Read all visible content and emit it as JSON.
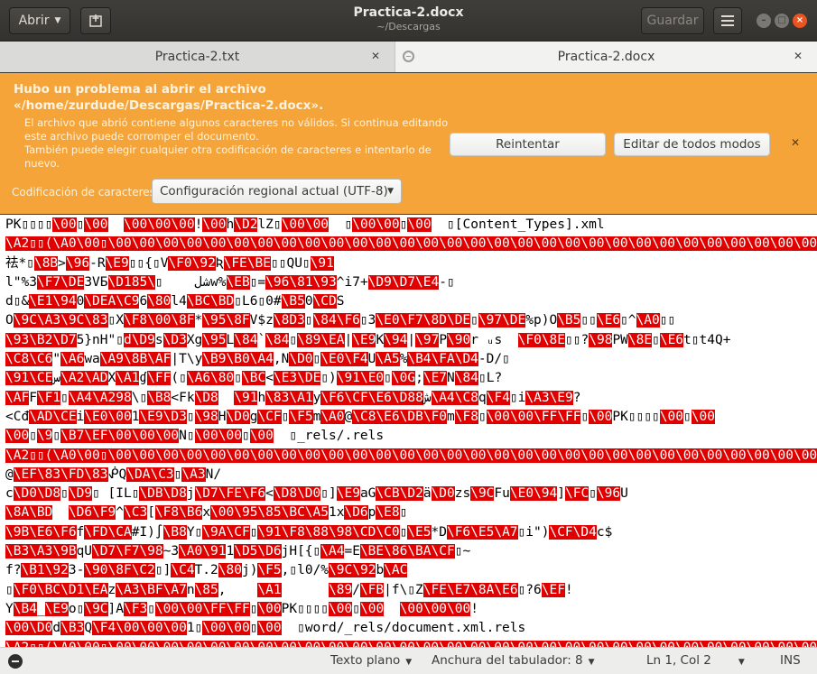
{
  "header": {
    "open_label": "Abrir",
    "title": "Practica-2.docx",
    "subtitle": "~/Descargas",
    "save_label": "Guardar"
  },
  "tabs": [
    {
      "label": "Practica-2.txt"
    },
    {
      "label": "Practica-2.docx"
    }
  ],
  "infobar": {
    "title": "Hubo un problema al abrir el archivo «/home/zurdude/Descargas/Practica-2.docx».",
    "desc": "El archivo que abrió contiene algunos caracteres no válidos. Si continua editando este archivo puede corromper el documento.\nTambién puede elegir cualquier otra codificación de caracteres e intentarlo de nuevo.",
    "retry_label": "Reintentar",
    "edit_anyway_label": "Editar de todos modos",
    "encoding_label": "Codificación de caracteres:",
    "encoding_value": "Configuración regional actual (UTF-8)"
  },
  "editor": {
    "lines": [
      [
        [
          "PK▯▯▯▯",
          0
        ],
        [
          "\\00",
          1
        ],
        [
          "▯",
          0
        ],
        [
          "\\00",
          1
        ],
        [
          "  ",
          0
        ],
        [
          "\\00\\00\\00",
          1
        ],
        [
          "!",
          0
        ],
        [
          "\\00",
          1
        ],
        [
          "h",
          0
        ],
        [
          "\\D2",
          1
        ],
        [
          "lZ▯",
          0
        ],
        [
          "\\00\\00",
          1
        ],
        [
          "  ▯",
          0
        ],
        [
          "\\00\\00",
          1
        ],
        [
          "▯",
          0
        ],
        [
          "\\00",
          1
        ],
        [
          "  ▯[Content_Types].xml",
          0
        ]
      ],
      [
        [
          "\\A2▯▯(\\A0\\00▯\\00\\00\\00\\00\\00\\00\\00\\00\\00\\00\\00\\00\\00\\00\\00\\00\\00\\00\\00\\00\\00\\00\\00\\00\\00\\00\\00\\00\\00\\00\\00\\00",
          1
        ]
      ],
      [
        [
          "祛*▯",
          0
        ],
        [
          "\\8B",
          1
        ],
        [
          ">",
          0
        ],
        [
          "\\96",
          1
        ],
        [
          "-R",
          0
        ],
        [
          "\\E9",
          1
        ],
        [
          "▯▯",
          0
        ],
        [
          "{▯V",
          0
        ],
        [
          "\\F0",
          1
        ],
        [
          "\\92",
          1
        ],
        [
          "Ʀ",
          0
        ],
        [
          "\\FE",
          1
        ],
        [
          "\\BE",
          1
        ],
        [
          "▯▯QU▯",
          0
        ],
        [
          "\\91",
          1
        ]
      ],
      [
        [
          "l\"%3",
          0
        ],
        [
          "\\F7\\DE",
          1
        ],
        [
          "3VБ",
          0
        ],
        [
          "\\D1",
          1
        ],
        [
          "شل    ▯",
          0
        ],
        [
          "\\85",
          1
        ],
        [
          "w%",
          0
        ],
        [
          "\\EB",
          1
        ],
        [
          "▯=",
          0
        ],
        [
          "\\96\\81\\93",
          1
        ],
        [
          "^i7+",
          0
        ],
        [
          "\\D9\\D7\\E4",
          1
        ],
        [
          "-▯",
          0
        ]
      ],
      [
        [
          "d▯&",
          0
        ],
        [
          "\\E1\\94",
          1
        ],
        [
          "0",
          0
        ],
        [
          "\\DEA",
          1
        ],
        [
          "\\C9",
          1
        ],
        [
          "6",
          0
        ],
        [
          "\\80",
          1
        ],
        [
          "l4",
          0
        ],
        [
          "\\BC\\BD",
          1
        ],
        [
          "▯L6▯0#",
          0
        ],
        [
          "\\B5",
          1
        ],
        [
          "0",
          0
        ],
        [
          "\\CD",
          1
        ],
        [
          "S",
          0
        ]
      ],
      [
        [
          "O",
          0
        ],
        [
          "\\9C\\A3\\9C\\83",
          1
        ],
        [
          "▯X",
          0
        ],
        [
          "\\F8\\00\\8F",
          1
        ],
        [
          "*",
          0
        ],
        [
          "\\95\\8F",
          1
        ],
        [
          "V$z",
          0
        ],
        [
          "\\8D3",
          1
        ],
        [
          "▯",
          0
        ],
        [
          "\\84\\F6",
          1
        ],
        [
          "▯3",
          0
        ],
        [
          "\\E0\\F7\\8D\\DE",
          1
        ],
        [
          "▯",
          0
        ],
        [
          "\\97\\DE",
          1
        ],
        [
          "%p)O",
          0
        ],
        [
          "\\B5",
          1
        ],
        [
          "▯▯",
          0
        ],
        [
          "\\E6",
          1
        ],
        [
          "▯^",
          0
        ],
        [
          "\\A0",
          1
        ],
        [
          "▯▯",
          0
        ]
      ],
      [
        [
          "\\93\\B2\\D7",
          1
        ],
        [
          "5}nH\"",
          0
        ],
        [
          "▯",
          0
        ],
        [
          "d\\D9",
          1
        ],
        [
          "s",
          0
        ],
        [
          "\\D3",
          1
        ],
        [
          "Xg",
          0
        ],
        [
          "\\95",
          1
        ],
        [
          "L",
          0
        ],
        [
          "\\84",
          1
        ],
        [
          "`",
          0
        ],
        [
          "\\84",
          1
        ],
        [
          "▯",
          0
        ],
        [
          "\\89\\EA",
          1
        ],
        [
          "|",
          0
        ],
        [
          "\\E9",
          1
        ],
        [
          "K",
          0
        ],
        [
          "\\94",
          1
        ],
        [
          "|",
          0
        ],
        [
          "\\97",
          1
        ],
        [
          "P",
          0
        ],
        [
          "\\90",
          1
        ],
        [
          "r ᵤs  ",
          0
        ],
        [
          "\\F0\\8E",
          1
        ],
        [
          "▯▯?",
          0
        ],
        [
          "\\98",
          1
        ],
        [
          "PW",
          0
        ],
        [
          "\\8E",
          1
        ],
        [
          "▯",
          0
        ],
        [
          "\\E6",
          1
        ],
        [
          "t▯t4Q+",
          0
        ]
      ],
      [
        [
          "\\C8\\C6",
          1
        ],
        [
          "\"",
          0
        ],
        [
          "\\A6",
          1
        ],
        [
          "wa",
          0
        ],
        [
          "\\A9\\8B\\AF",
          1
        ],
        [
          "|T\\y",
          0
        ],
        [
          "\\B9\\B0\\A4",
          1
        ],
        [
          ",N",
          0
        ],
        [
          "\\D0",
          1
        ],
        [
          "▯",
          0
        ],
        [
          "\\E0\\F4",
          1
        ],
        [
          "U",
          0
        ],
        [
          "\\A5",
          1
        ],
        [
          "%",
          0
        ],
        [
          "\\B4\\FA\\D4",
          1
        ],
        [
          "-D/▯",
          0
        ]
      ],
      [
        [
          "\\91\\CE",
          1
        ],
        [
          "س",
          0
        ],
        [
          "\\A2\\AD",
          1
        ],
        [
          "X",
          0
        ],
        [
          "\\A1",
          1
        ],
        [
          "ɠ",
          0
        ],
        [
          "\\FF",
          1
        ],
        [
          "(▯",
          0
        ],
        [
          "\\A6\\80",
          1
        ],
        [
          "▯",
          0
        ],
        [
          "\\BC",
          1
        ],
        [
          "<",
          0
        ],
        [
          "\\E3\\DE",
          1
        ],
        [
          "▯)",
          0
        ],
        [
          "\\91\\E0",
          1
        ],
        [
          "▯",
          0
        ],
        [
          "\\0G",
          1
        ],
        [
          ";",
          0
        ],
        [
          "\\E7",
          1
        ],
        [
          "N",
          0
        ],
        [
          "\\84",
          1
        ],
        [
          "▯L?",
          0
        ]
      ],
      [
        [
          "\\AF",
          1
        ],
        [
          "F",
          0
        ],
        [
          "\\F1",
          1
        ],
        [
          "▯",
          0
        ],
        [
          "\\A4\\A298",
          1
        ],
        [
          "\\",
          0
        ],
        [
          "▯",
          0
        ],
        [
          "\\B8",
          1
        ],
        [
          "<Fk",
          0
        ],
        [
          "\\D8",
          1
        ],
        [
          "  ",
          0
        ],
        [
          "\\91",
          1
        ],
        [
          "h",
          0
        ],
        [
          "\\83",
          1
        ],
        [
          "\\A1",
          1
        ],
        [
          "y",
          0
        ],
        [
          "\\F6\\CF\\E6\\D88",
          1
        ],
        [
          "ش",
          0
        ],
        [
          "\\A4\\C8",
          1
        ],
        [
          "q",
          0
        ],
        [
          "\\F4",
          1
        ],
        [
          "▯i",
          0
        ],
        [
          "\\A3\\E9",
          1
        ],
        [
          "?",
          0
        ]
      ],
      [
        [
          "<Cđ",
          0
        ],
        [
          "\\AD\\CE",
          1
        ],
        [
          "i",
          0
        ],
        [
          "\\E0\\00",
          1
        ],
        [
          "1",
          0
        ],
        [
          "\\E9\\D3",
          1
        ],
        [
          "▯",
          0
        ],
        [
          "\\98",
          1
        ],
        [
          "H",
          0
        ],
        [
          "\\D0",
          1
        ],
        [
          "g",
          0
        ],
        [
          "\\CF",
          1
        ],
        [
          "▯",
          0
        ],
        [
          "\\F5",
          1
        ],
        [
          "m",
          0
        ],
        [
          "\\A0",
          1
        ],
        [
          "@",
          0
        ],
        [
          "\\C8\\E6\\DB\\F0",
          1
        ],
        [
          "m",
          0
        ],
        [
          "\\F8",
          1
        ],
        [
          "▯",
          0
        ],
        [
          "\\00\\00\\FF\\FF",
          1
        ],
        [
          "▯",
          0
        ],
        [
          "\\00",
          1
        ],
        [
          "PK▯▯▯▯",
          0
        ],
        [
          "\\00",
          1
        ],
        [
          "▯",
          0
        ],
        [
          "\\00",
          1
        ]
      ],
      [
        [
          "\\00",
          1
        ],
        [
          "▯",
          0
        ],
        [
          "\\9",
          1
        ],
        [
          "▯",
          0
        ],
        [
          "\\B7\\EF\\00\\00\\00",
          1
        ],
        [
          "N▯",
          0
        ],
        [
          "\\00\\00",
          1
        ],
        [
          "▯",
          0
        ],
        [
          "\\00",
          1
        ],
        [
          "  ▯_rels/.rels",
          0
        ]
      ],
      [
        [
          "\\A2▯▯(\\A0\\00▯\\00\\00\\00\\00\\00\\00\\00\\00\\00\\00\\00\\00\\00\\00\\00\\00\\00\\00\\00\\00\\00\\00\\00\\00\\00\\00\\00\\00\\00\\00\\00",
          1
        ]
      ],
      [
        [
          "@",
          0
        ],
        [
          "\\EF\\83\\FD\\83",
          1
        ],
        [
          "ᕶQ",
          0
        ],
        [
          "\\DA\\C3",
          1
        ],
        [
          "▯",
          0
        ],
        [
          "\\A3",
          1
        ],
        [
          "N/",
          0
        ]
      ],
      [
        [
          "c",
          0
        ],
        [
          "\\D0\\D8",
          1
        ],
        [
          "▯",
          0
        ],
        [
          "\\D9",
          1
        ],
        [
          "▯ [IL▯",
          0
        ],
        [
          "\\DB\\D8",
          1
        ],
        [
          "j",
          0
        ],
        [
          "\\D7\\FE\\F6",
          1
        ],
        [
          "<",
          0
        ],
        [
          "\\D8\\D0",
          1
        ],
        [
          "▯]",
          0
        ],
        [
          "\\E9",
          1
        ],
        [
          "aG",
          0
        ],
        [
          "\\CB\\D2",
          1
        ],
        [
          "ä",
          0
        ],
        [
          "\\D0",
          1
        ],
        [
          "zs",
          0
        ],
        [
          "\\9C",
          1
        ],
        [
          "Fu",
          0
        ],
        [
          "\\E0\\94",
          1
        ],
        [
          "]",
          0
        ],
        [
          "\\FC",
          1
        ],
        [
          "▯",
          0
        ],
        [
          "\\96",
          1
        ],
        [
          "U",
          0
        ]
      ],
      [
        [
          "\\8A\\BD",
          1
        ],
        [
          "  ",
          0
        ],
        [
          "\\D6\\F9",
          1
        ],
        [
          "^",
          0
        ],
        [
          "\\C3",
          1
        ],
        [
          "[",
          0
        ],
        [
          "\\F8\\B6",
          1
        ],
        [
          "x",
          0
        ],
        [
          "\\00\\95\\85\\BC\\A5",
          1
        ],
        [
          "1x",
          0
        ],
        [
          "\\D6",
          1
        ],
        [
          "p",
          0
        ],
        [
          "\\E8",
          1
        ],
        [
          "▯",
          0
        ]
      ],
      [
        [
          "\\9B\\E6\\F6",
          1
        ],
        [
          "f",
          0
        ],
        [
          "\\FD\\CA",
          1
        ],
        [
          "#I)∫",
          0
        ],
        [
          "\\B8",
          1
        ],
        [
          "Y▯",
          0
        ],
        [
          "\\9A\\CF",
          1
        ],
        [
          "▯",
          0
        ],
        [
          "\\91\\F8\\88\\98\\CD\\C0",
          1
        ],
        [
          "▯",
          0
        ],
        [
          "\\E5",
          1
        ],
        [
          "*D",
          0
        ],
        [
          "\\F6\\E5\\A7",
          1
        ],
        [
          "▯i\")",
          0
        ],
        [
          "\\CF\\D4",
          1
        ],
        [
          "c$",
          0
        ]
      ],
      [
        [
          "\\B3\\A3\\9B",
          1
        ],
        [
          "qU",
          0
        ],
        [
          "\\D7\\F7\\98",
          1
        ],
        [
          "~3",
          0
        ],
        [
          "\\A0\\91",
          1
        ],
        [
          "1",
          0
        ],
        [
          "\\D5\\D6",
          1
        ],
        [
          "jH[{▯",
          0
        ],
        [
          "\\A4",
          1
        ],
        [
          "=E",
          0
        ],
        [
          "\\BE\\86",
          1
        ],
        [
          "\\BA\\CF",
          1
        ],
        [
          "▯~",
          0
        ]
      ],
      [
        [
          "f?",
          0
        ],
        [
          "\\B1\\92",
          1
        ],
        [
          "3-",
          0
        ],
        [
          "\\90\\8F\\C2",
          1
        ],
        [
          "▯]",
          0
        ],
        [
          "\\C4",
          1
        ],
        [
          "T.2",
          0
        ],
        [
          "\\80",
          1
        ],
        [
          "j)",
          0
        ],
        [
          "\\F5",
          1
        ],
        [
          ",▯l0/%",
          0
        ],
        [
          "\\9C\\92",
          1
        ],
        [
          "b",
          0
        ],
        [
          "\\AC",
          1
        ]
      ],
      [
        [
          "▯",
          0
        ],
        [
          "\\F0\\BC\\D1\\EA",
          1
        ],
        [
          "z",
          0
        ],
        [
          "\\A3\\BF\\A7",
          1
        ],
        [
          "n",
          0
        ],
        [
          "\\85",
          1
        ],
        [
          ",    ",
          0
        ],
        [
          "\\A1",
          1
        ],
        [
          "      ",
          0
        ],
        [
          "\\89",
          1
        ],
        [
          "/",
          0
        ],
        [
          "\\FB",
          1
        ],
        [
          "|f\\▯Z",
          0
        ],
        [
          "\\FE\\E7\\8A\\E6",
          1
        ],
        [
          "▯?6",
          0
        ],
        [
          "\\EF",
          1
        ],
        [
          "!",
          0
        ]
      ],
      [
        [
          "Y",
          0
        ],
        [
          "\\B4",
          1
        ],
        [
          "_",
          0
        ],
        [
          "\\E9",
          1
        ],
        [
          "o▯",
          0
        ],
        [
          "\\9C",
          1
        ],
        [
          "]A",
          0
        ],
        [
          "\\F3",
          1
        ],
        [
          "▯",
          0
        ],
        [
          "\\00\\00\\FF\\FF",
          1
        ],
        [
          "▯",
          0
        ],
        [
          "\\00",
          1
        ],
        [
          "PK▯▯▯▯",
          0
        ],
        [
          "\\00",
          1
        ],
        [
          "▯",
          0
        ],
        [
          "\\00",
          1
        ],
        [
          "  ",
          0
        ],
        [
          "\\00\\00\\00",
          1
        ],
        [
          "!",
          0
        ]
      ],
      [
        [
          "\\00\\D0",
          1
        ],
        [
          "d",
          0
        ],
        [
          "\\B3",
          1
        ],
        [
          "Q",
          0
        ],
        [
          "\\F4\\00\\00\\00",
          1
        ],
        [
          "1▯",
          0
        ],
        [
          "\\00\\00",
          1
        ],
        [
          "▯",
          0
        ],
        [
          "\\00",
          1
        ],
        [
          "  ▯word/_rels/document.xml.rels",
          0
        ]
      ],
      [
        [
          "\\A2▯▯(\\A0\\00▯\\00\\00\\00\\00\\00\\00\\00\\00\\00\\00\\00\\00\\00\\00\\00\\00\\00\\00\\00\\00\\00\\00\\00\\00\\00\\00\\00\\00\\00\\00",
          1
        ]
      ]
    ]
  },
  "statusbar": {
    "syntax_label": "Texto plano",
    "tab_width_label": "Anchura del tabulador: 8",
    "position_label": "Ln 1, Col 2",
    "mode_label": "INS"
  },
  "colors": {
    "infobar": "#f4a438",
    "invalid_highlight": "#e00000",
    "close_button": "#e95420"
  }
}
